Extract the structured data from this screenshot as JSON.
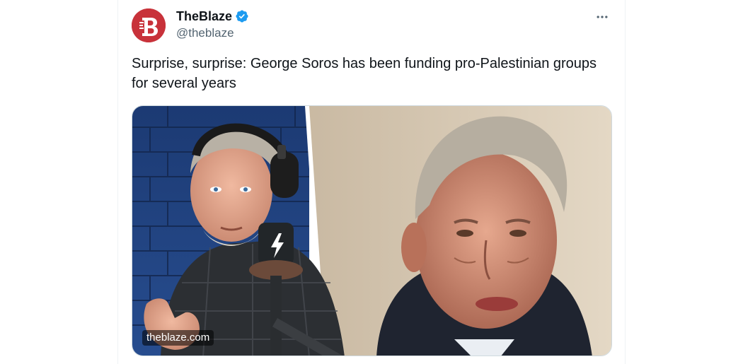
{
  "tweet": {
    "author": {
      "display_name": "TheBlaze",
      "handle": "@theblaze",
      "avatar_letter": "B",
      "verified": true
    },
    "text": "Surprise, surprise: George Soros has been funding pro-Palestinian groups for several years",
    "media": {
      "watermark": "theblaze.com"
    }
  },
  "icons": {
    "verified": "verified-badge-icon",
    "more": "more-options-icon",
    "lightning": "lightning-icon"
  },
  "colors": {
    "brand_red": "#c8323a",
    "verified_blue": "#1d9bf0",
    "text_primary": "#0f1419",
    "text_secondary": "#536471"
  }
}
